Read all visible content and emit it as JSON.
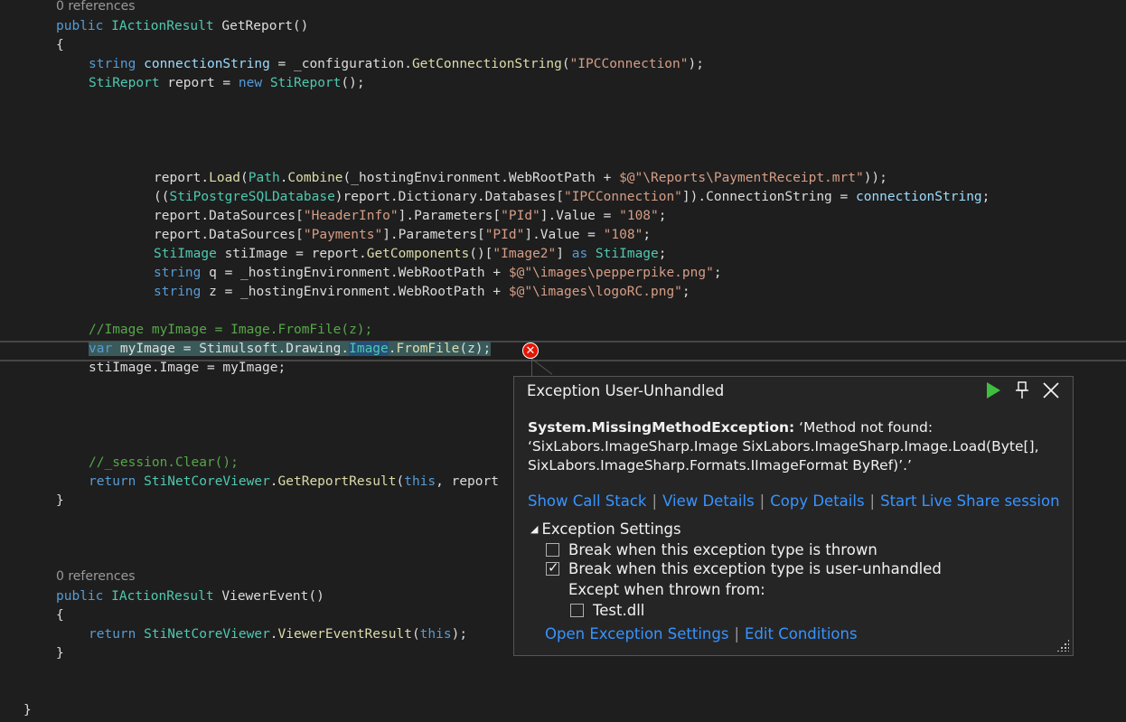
{
  "code": {
    "refs_1": "0 references",
    "sig1_kw": "public",
    "sig1_type": "IActionResult",
    "sig1_name": " GetReport()",
    "brace_open": "{",
    "brace_close": "}",
    "line_conn": {
      "kw": "string",
      "var": " connectionString",
      "mid": " = _configuration.",
      "method": "GetConnectionString",
      "open": "(",
      "str": "\"IPCConnection\"",
      "end": ");"
    },
    "line_report": {
      "type": "StiReport",
      "mid": " report = ",
      "kw": "new",
      "type2": " StiReport",
      "end": "();"
    },
    "line_load": {
      "a": "report.",
      "m": "Load",
      "b": "(",
      "t": "Path",
      "c": ".",
      "m2": "Combine",
      "d": "(_hostingEnvironment.WebRootPath + ",
      "s": "$@\"\\Reports\\PaymentReceipt.mrt\"",
      "e": "));"
    },
    "line_db": {
      "a": "((",
      "t": "StiPostgreSQLDatabase",
      "b": ")report.Dictionary.Databases[",
      "s": "\"IPCConnection\"",
      "c": "]).ConnectionString = ",
      "v": "connectionString",
      "e": ";"
    },
    "line_ds1": {
      "a": "report.DataSources[",
      "s1": "\"HeaderInfo\"",
      "b": "].Parameters[",
      "s2": "\"PId\"",
      "c": "].Value = ",
      "s3": "\"108\"",
      "e": ";"
    },
    "line_ds2": {
      "a": "report.DataSources[",
      "s1": "\"Payments\"",
      "b": "].Parameters[",
      "s2": "\"PId\"",
      "c": "].Value = ",
      "s3": "\"108\"",
      "e": ";"
    },
    "line_sti": {
      "t": "StiImage",
      "a": " stiImage = report.",
      "m": "GetComponents",
      "b": "()[",
      "s": "\"Image2\"",
      "c": "] ",
      "kw": "as",
      "t2": " StiImage",
      "e": ";"
    },
    "line_q": {
      "kw": "string",
      "a": " q = _hostingEnvironment.WebRootPath + ",
      "s": "$@\"\\images\\pepperpike.png\"",
      "e": ";"
    },
    "line_z": {
      "kw": "string",
      "a": " z = _hostingEnvironment.WebRootPath + ",
      "s": "$@\"\\images\\logoRC.png\"",
      "e": ";"
    },
    "line_comment1": "//Image myImage = Image.FromFile(z);",
    "line_var": {
      "kw": "var",
      "a": " myImage = Stimulsoft.Drawing.",
      "t": "Image",
      "b": ".",
      "m": "FromFile",
      "e": "(z);"
    },
    "line_assign": "stiImage.Image = myImage;",
    "line_comment2": "//_session.Clear();",
    "line_return1": {
      "kw": "return",
      "t": " StiNetCoreViewer",
      "a": ".",
      "m": "GetReportResult",
      "b": "(",
      "kw2": "this",
      "e": ", report"
    },
    "refs_2": "0 references",
    "sig2_kw": "public",
    "sig2_type": "IActionResult",
    "sig2_name": " ViewerEvent()",
    "line_return2": {
      "kw": "return",
      "t": " StiNetCoreViewer",
      "a": ".",
      "m": "ViewerEventResult",
      "b": "(",
      "kw2": "this",
      "e": ");"
    },
    "final_brace": "}"
  },
  "exception": {
    "title": "Exception User-Unhandled",
    "type": "System.MissingMethodException:",
    "message": " ‘Method not found: ‘SixLabors.ImageSharp.Image SixLabors.ImageSharp.Image.Load(Byte[], SixLabors.ImageSharp.Formats.IImageFormat ByRef)’.’",
    "links": [
      "Show Call Stack",
      "View Details",
      "Copy Details",
      "Start Live Share session"
    ],
    "settings_title": "Exception Settings",
    "opt_thrown": "Break when this exception type is thrown",
    "opt_unhandled": "Break when this exception type is user-unhandled",
    "except_label": "Except when thrown from:",
    "dll": "Test.dll",
    "open_settings": "Open Exception Settings",
    "edit_conditions": "Edit Conditions",
    "icons": [
      "continue-play-icon",
      "pin-icon",
      "close-icon"
    ]
  },
  "colors": {
    "background": "#1e1e1e",
    "keyword": "#569cd6",
    "type": "#4ec9b0",
    "string": "#d69d85",
    "comment": "#57a64a",
    "link": "#3794ff",
    "error": "#e51400"
  }
}
